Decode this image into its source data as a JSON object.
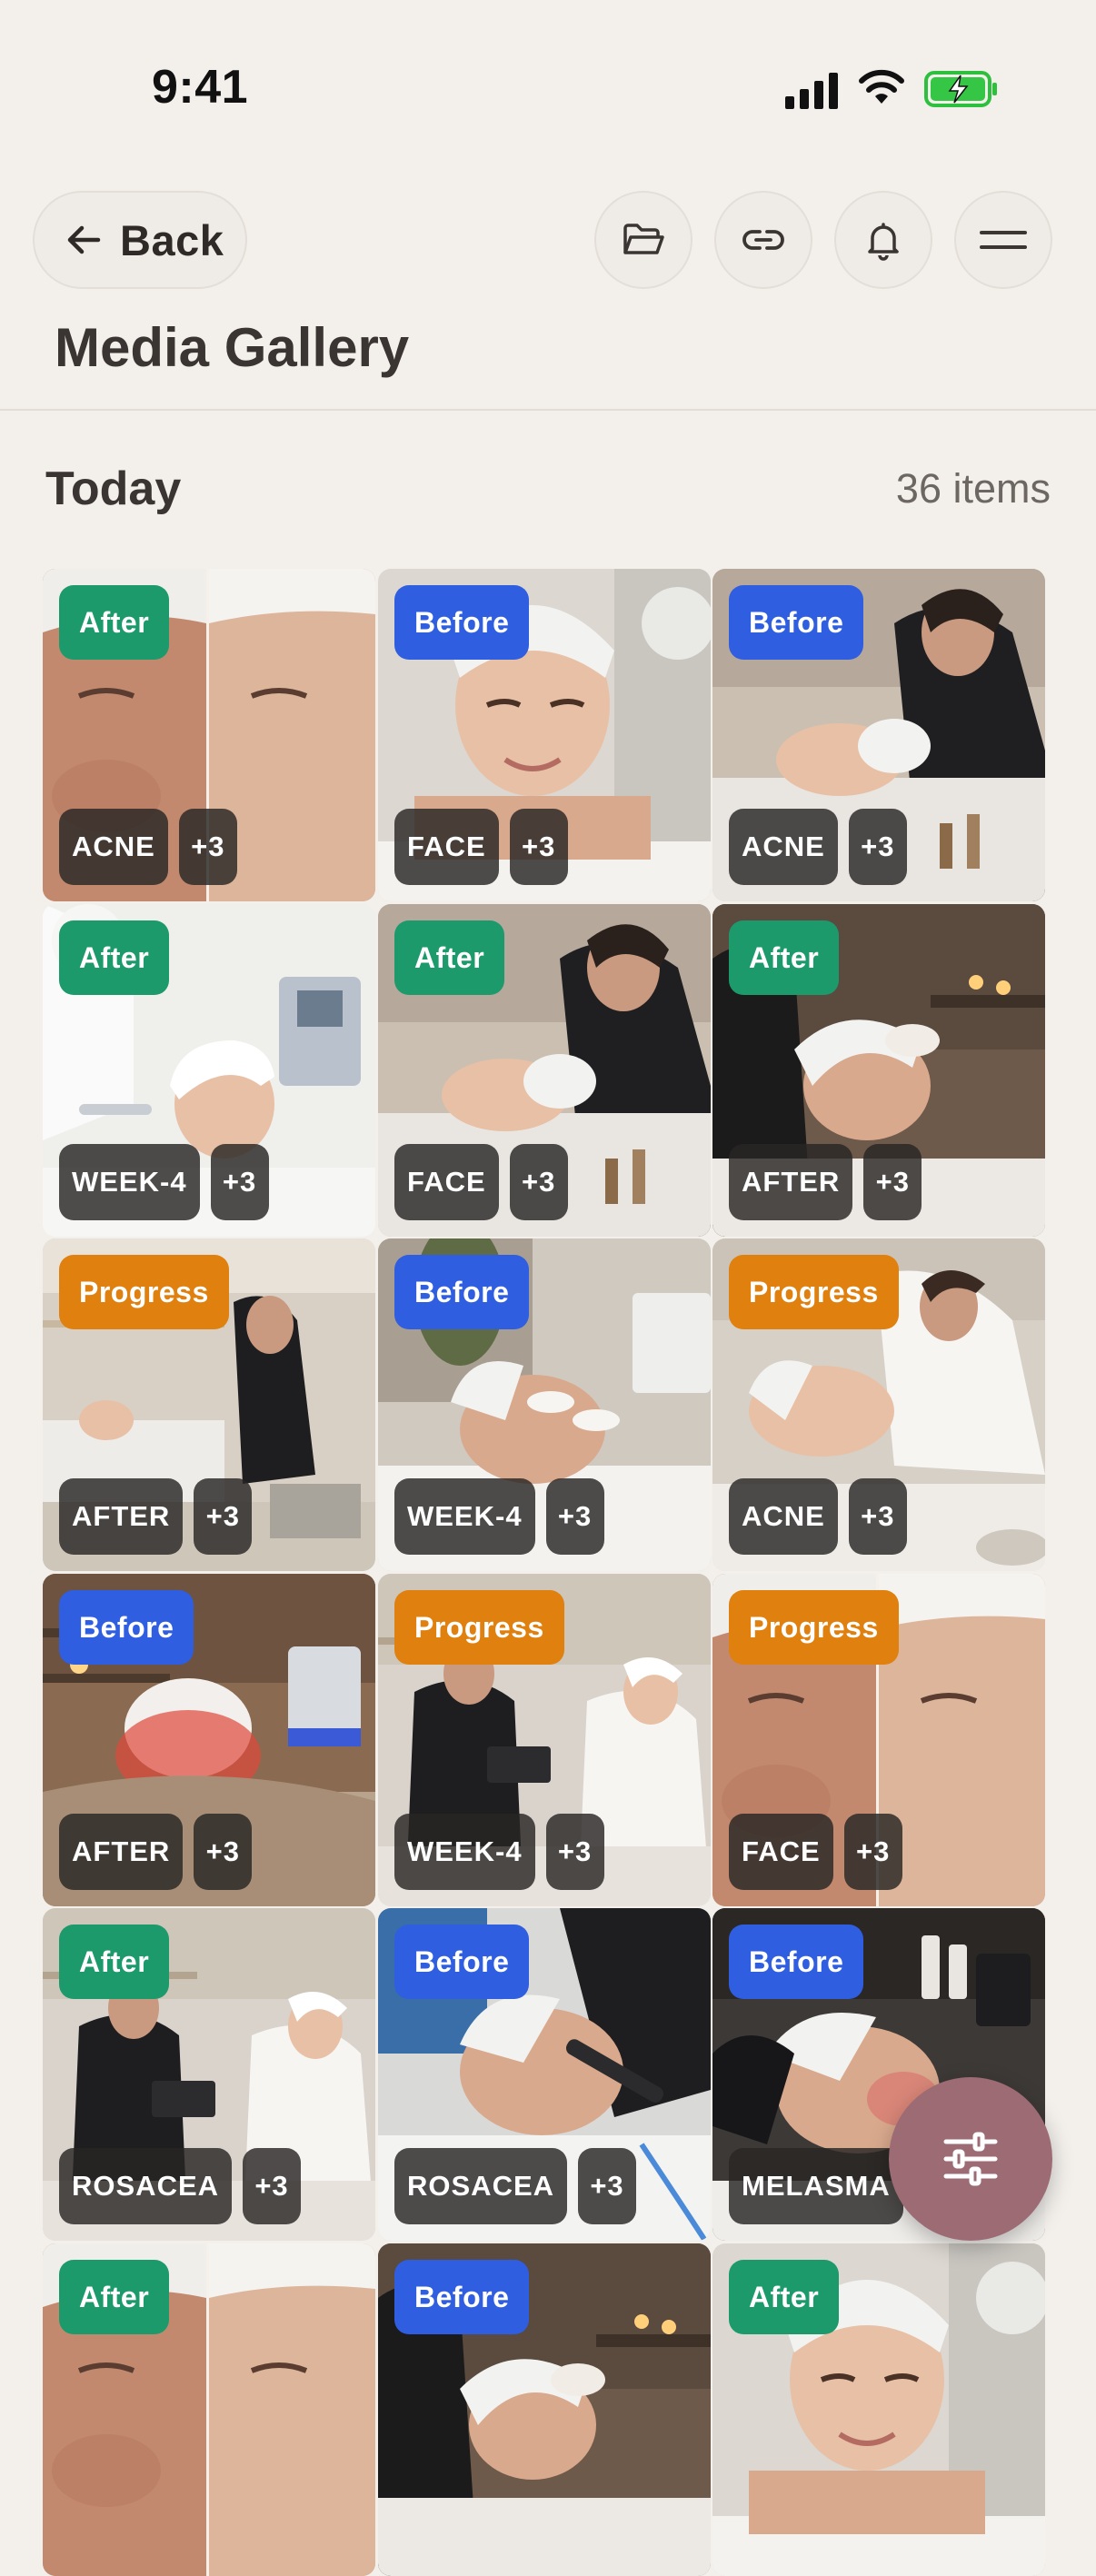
{
  "status_bar": {
    "time": "9:41"
  },
  "header": {
    "back_label": "Back",
    "page_title": "Media Gallery"
  },
  "section": {
    "title": "Today",
    "count": "36 items"
  },
  "tiles": [
    {
      "status": "After",
      "status_type": "after",
      "tag": "ACNE",
      "more": "+3",
      "theme": "split-face"
    },
    {
      "status": "Before",
      "status_type": "before",
      "tag": "FACE",
      "more": "+3",
      "theme": "portrait"
    },
    {
      "status": "Before",
      "status_type": "before",
      "tag": "ACNE",
      "more": "+3",
      "theme": "treatment"
    },
    {
      "status": "After",
      "status_type": "after",
      "tag": "WEEK-4",
      "more": "+3",
      "theme": "bright-clinic"
    },
    {
      "status": "After",
      "status_type": "after",
      "tag": "FACE",
      "more": "+3",
      "theme": "treatment"
    },
    {
      "status": "After",
      "status_type": "after",
      "tag": "AFTER",
      "more": "+3",
      "theme": "candle-room"
    },
    {
      "status": "Progress",
      "status_type": "progress",
      "tag": "AFTER",
      "more": "+3",
      "theme": "clinic-room"
    },
    {
      "status": "Before",
      "status_type": "before",
      "tag": "WEEK-4",
      "more": "+3",
      "theme": "eye-patches"
    },
    {
      "status": "Progress",
      "status_type": "progress",
      "tag": "ACNE",
      "more": "+3",
      "theme": "massage"
    },
    {
      "status": "Before",
      "status_type": "before",
      "tag": "AFTER",
      "more": "+3",
      "theme": "led-mask"
    },
    {
      "status": "Progress",
      "status_type": "progress",
      "tag": "WEEK-4",
      "more": "+3",
      "theme": "consult"
    },
    {
      "status": "Progress",
      "status_type": "progress",
      "tag": "FACE",
      "more": "+3",
      "theme": "split-face"
    },
    {
      "status": "After",
      "status_type": "after",
      "tag": "ROSACEA",
      "more": "+3",
      "theme": "consult"
    },
    {
      "status": "Before",
      "status_type": "before",
      "tag": "ROSACEA",
      "more": "+3",
      "theme": "device-blue"
    },
    {
      "status": "Before",
      "status_type": "before",
      "tag": "MELASMA",
      "more": "",
      "theme": "device-dark"
    },
    {
      "status": "After",
      "status_type": "after",
      "tag": "",
      "more": "",
      "theme": "split-face"
    },
    {
      "status": "Before",
      "status_type": "before",
      "tag": "",
      "more": "",
      "theme": "candle-room"
    },
    {
      "status": "After",
      "status_type": "after",
      "tag": "",
      "more": "",
      "theme": "portrait"
    }
  ],
  "colors": {
    "after": "#1d9a6c",
    "before": "#2f5ee0",
    "progress": "#e0800e",
    "fab": "#9d6b73"
  },
  "icons": {
    "back": "arrow-left-icon",
    "folder": "folder-open-icon",
    "link": "link-icon",
    "bell": "bell-icon",
    "menu": "menu-icon",
    "fab": "sliders-icon"
  }
}
